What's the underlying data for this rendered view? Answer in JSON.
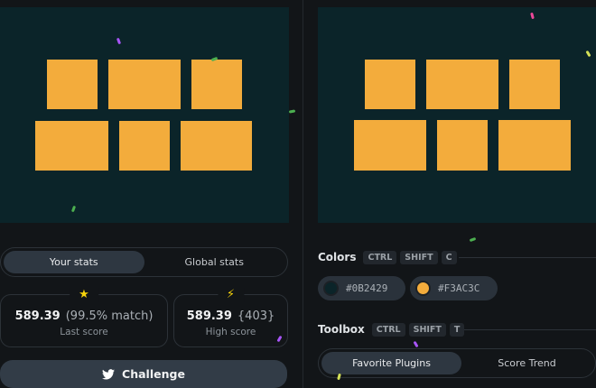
{
  "colors": {
    "background": "#0B2429",
    "foreground": "#F3AC3C"
  },
  "stats": {
    "tabs": [
      {
        "label": "Your stats",
        "active": true
      },
      {
        "label": "Global stats",
        "active": false
      }
    ],
    "last": {
      "icon": "star-icon",
      "value": "589.39",
      "detail": "(99.5% match)",
      "label": "Last score"
    },
    "high": {
      "icon": "lightning-icon",
      "value": "589.39",
      "detail": "{403}",
      "label": "High score"
    },
    "challenge_label": "Challenge"
  },
  "colors_section": {
    "title": "Colors",
    "keys": [
      "CTRL",
      "SHIFT",
      "C"
    ],
    "swatches": [
      "#0B2429",
      "#F3AC3C"
    ]
  },
  "toolbox": {
    "title": "Toolbox",
    "keys": [
      "CTRL",
      "SHIFT",
      "T"
    ],
    "tabs": [
      {
        "label": "Favorite Plugins",
        "active": true
      },
      {
        "label": "Score Trend",
        "active": false
      }
    ]
  }
}
